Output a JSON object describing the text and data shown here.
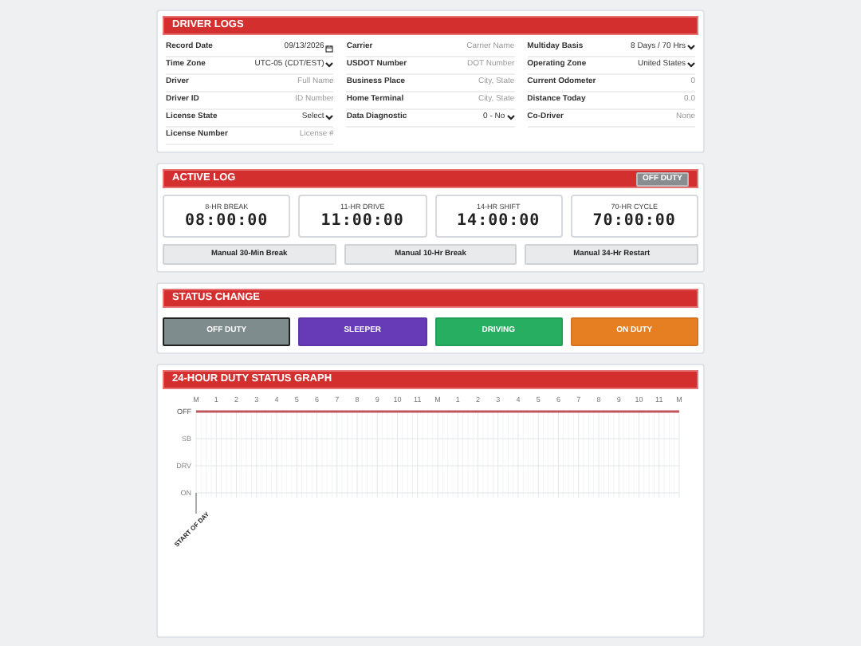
{
  "driver_logs": {
    "title": "DRIVER LOGS",
    "columns": [
      [
        {
          "label": "Record Date",
          "kind": "date",
          "value": "09/13/2026"
        },
        {
          "label": "Time Zone",
          "kind": "select",
          "value": "UTC-05 (CDT/EST)"
        },
        {
          "label": "Driver",
          "kind": "input",
          "placeholder": "Full Name"
        },
        {
          "label": "Driver ID",
          "kind": "input",
          "placeholder": "ID Number"
        },
        {
          "label": "License State",
          "kind": "select",
          "value": "Select"
        },
        {
          "label": "License Number",
          "kind": "input",
          "placeholder": "License #"
        }
      ],
      [
        {
          "label": "Carrier",
          "kind": "input",
          "placeholder": "Carrier Name"
        },
        {
          "label": "USDOT Number",
          "kind": "input",
          "placeholder": "DOT Number"
        },
        {
          "label": "Business Place",
          "kind": "input",
          "placeholder": "City, State"
        },
        {
          "label": "Home Terminal",
          "kind": "input",
          "placeholder": "City, State"
        },
        {
          "label": "Data Diagnostic",
          "kind": "select",
          "value": "0 - No"
        }
      ],
      [
        {
          "label": "Multiday Basis",
          "kind": "select",
          "value": "8 Days / 70 Hrs"
        },
        {
          "label": "Operating Zone",
          "kind": "select",
          "value": "United States"
        },
        {
          "label": "Current Odometer",
          "kind": "input",
          "placeholder": "0"
        },
        {
          "label": "Distance Today",
          "kind": "input",
          "placeholder": "0.0"
        },
        {
          "label": "Co-Driver",
          "kind": "input",
          "placeholder": "None"
        }
      ]
    ]
  },
  "active_log": {
    "title": "ACTIVE LOG",
    "status_badge": "OFF DUTY",
    "timers": [
      {
        "label": "8-HR BREAK",
        "time": "08:00:00"
      },
      {
        "label": "11-HR DRIVE",
        "time": "11:00:00"
      },
      {
        "label": "14-HR SHIFT",
        "time": "14:00:00"
      },
      {
        "label": "70-HR CYCLE",
        "time": "70:00:00"
      }
    ],
    "buttons": [
      "Manual 30-Min Break",
      "Manual 10-Hr Break",
      "Manual 34-Hr Restart"
    ]
  },
  "status_change": {
    "title": "STATUS CHANGE",
    "buttons": [
      {
        "label": "OFF DUTY",
        "kind": "off",
        "selected": true
      },
      {
        "label": "SLEEPER",
        "kind": "sleeper",
        "selected": false
      },
      {
        "label": "DRIVING",
        "kind": "driving",
        "selected": false
      },
      {
        "label": "ON DUTY",
        "kind": "on",
        "selected": false
      }
    ]
  },
  "graph": {
    "title": "24-HOUR DUTY STATUS GRAPH",
    "start_label": "START OF DAY",
    "hour_labels": [
      "M",
      "1",
      "2",
      "3",
      "4",
      "5",
      "6",
      "7",
      "8",
      "9",
      "10",
      "11",
      "M",
      "1",
      "2",
      "3",
      "4",
      "5",
      "6",
      "7",
      "8",
      "9",
      "10",
      "11",
      "M"
    ],
    "status_rows": [
      {
        "label": "OFF",
        "logged": true
      },
      {
        "label": "SB",
        "logged": false
      },
      {
        "label": "DRV",
        "logged": false
      },
      {
        "label": "ON",
        "logged": false
      }
    ]
  }
}
